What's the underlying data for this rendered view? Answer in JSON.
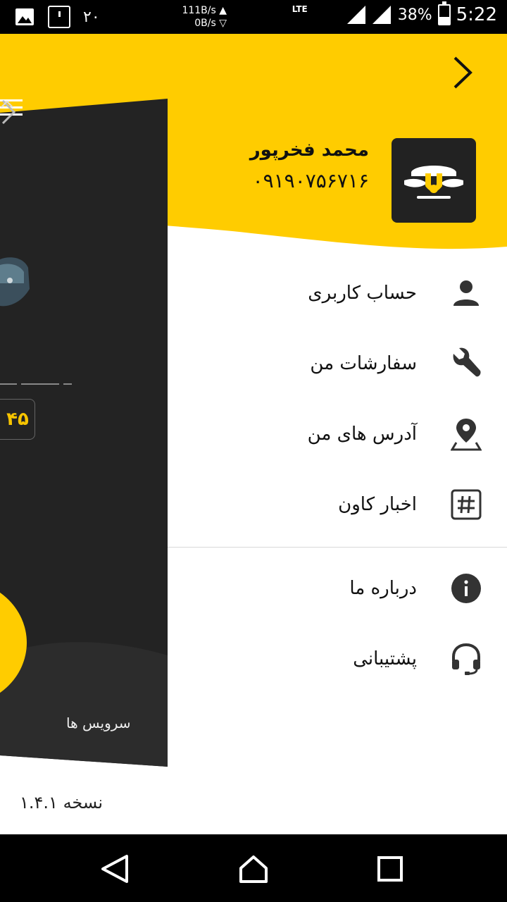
{
  "status_bar": {
    "notification_count": "۲۰",
    "net_up": "111B/s",
    "net_down": "0B/s",
    "network_type": "LTE",
    "battery": "38%",
    "time": "5:22"
  },
  "header": {
    "user_name": "محمد فخرپور",
    "user_phone": "۰۹۱۹۰۷۵۶۷۱۶",
    "accent_color": "#FFCC00"
  },
  "menu": {
    "items": [
      {
        "label": "حساب کاربری",
        "icon": "person-icon"
      },
      {
        "label": "سفارشات من",
        "icon": "wrench-icon"
      },
      {
        "label": "آدرس های من",
        "icon": "location-pin-icon"
      },
      {
        "label": "اخبار کاون",
        "icon": "hashtag-icon"
      },
      {
        "label": "درباره ما",
        "icon": "info-icon"
      },
      {
        "label": "پشتیبانی",
        "icon": "headset-icon"
      }
    ]
  },
  "version_label": "نسخه ۱.۴.۱",
  "preview": {
    "badge_value": "۴۵",
    "services_label": "سرویس ها"
  }
}
